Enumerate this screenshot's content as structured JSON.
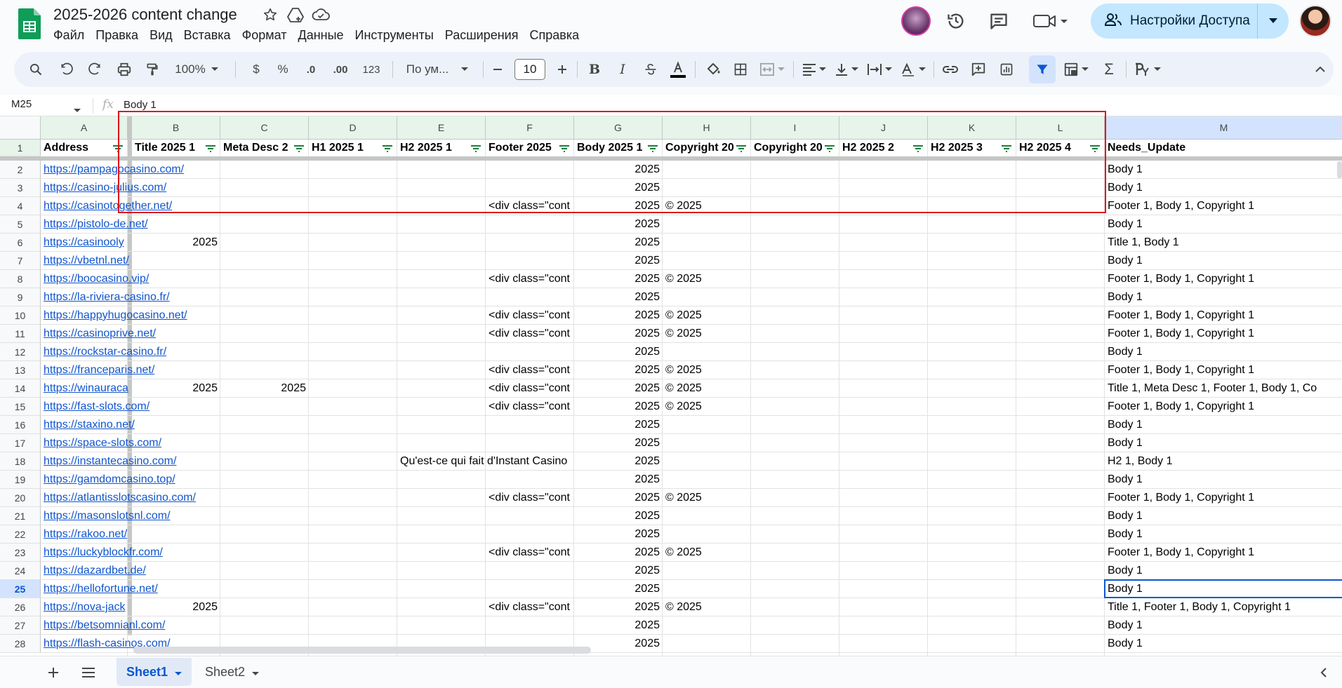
{
  "doc": {
    "title": "2025-2026 content change"
  },
  "menu": [
    "Файл",
    "Правка",
    "Вид",
    "Вставка",
    "Формат",
    "Данные",
    "Инструменты",
    "Расширения",
    "Справка"
  ],
  "share": {
    "label": "Настройки Доступа"
  },
  "toolbar": {
    "zoom": "100%",
    "currency": "$",
    "percent": "%",
    "dec_decrease": ".0",
    "dec_increase": ".00",
    "number_format": "123",
    "font": "По ум...",
    "font_size": "10"
  },
  "formula_bar": {
    "cell_ref": "M25",
    "value": "Body  1"
  },
  "columns": [
    "A",
    "B",
    "C",
    "D",
    "E",
    "F",
    "G",
    "H",
    "I",
    "J",
    "K",
    "L",
    "M"
  ],
  "headers": [
    "Address",
    "Title 2025 1",
    "Meta Desc 2",
    "H1 2025 1",
    "H2 2025 1",
    "Footer 2025",
    "Body 2025 1",
    "Copyright 20",
    "Copyright 20",
    "H2 2025 2",
    "H2 2025 3",
    "H2 2025 4",
    "Needs_Update"
  ],
  "rows": [
    {
      "n": "2",
      "address": "https://pampagocasino.com/",
      "b": "",
      "c": "",
      "e": "",
      "f": "",
      "g": "2025",
      "h": "",
      "m": "Body  1"
    },
    {
      "n": "3",
      "address": "https://casino-julius.com/",
      "b": "",
      "c": "",
      "e": "",
      "f": "",
      "g": "2025",
      "h": "",
      "m": "Body  1"
    },
    {
      "n": "4",
      "address": "https://casinotogether.net/",
      "b": "",
      "c": "",
      "e": "",
      "f": "<div class=\"cont",
      "g": "2025",
      "h": "© 2025",
      "m": "Footer  1, Body  1, Copyright  1"
    },
    {
      "n": "5",
      "address": "https://pistolo-de.net/",
      "b": "",
      "c": "",
      "e": "",
      "f": "",
      "g": "2025",
      "h": "",
      "m": "Body  1"
    },
    {
      "n": "6",
      "address": "https://casinooly",
      "b": "2025",
      "c": "",
      "e": "",
      "f": "",
      "g": "2025",
      "h": "",
      "m": "Title  1, Body  1"
    },
    {
      "n": "7",
      "address": "https://vbetnl.net/",
      "b": "",
      "c": "",
      "e": "",
      "f": "",
      "g": "2025",
      "h": "",
      "m": "Body  1"
    },
    {
      "n": "8",
      "address": "https://boocasino.vip/",
      "b": "",
      "c": "",
      "e": "",
      "f": "<div class=\"cont",
      "g": "2025",
      "h": "© 2025",
      "m": "Footer  1, Body  1, Copyright  1"
    },
    {
      "n": "9",
      "address": "https://la-riviera-casino.fr/",
      "b": "",
      "c": "",
      "e": "",
      "f": "",
      "g": "2025",
      "h": "",
      "m": "Body  1"
    },
    {
      "n": "10",
      "address": "https://happyhugocasino.net/",
      "b": "",
      "c": "",
      "e": "",
      "f": "<div class=\"cont",
      "g": "2025",
      "h": "© 2025",
      "m": "Footer  1, Body  1, Copyright  1"
    },
    {
      "n": "11",
      "address": "https://casinoprive.net/",
      "b": "",
      "c": "",
      "e": "",
      "f": "<div class=\"cont",
      "g": "2025",
      "h": "© 2025",
      "m": "Footer  1, Body  1, Copyright  1"
    },
    {
      "n": "12",
      "address": "https://rockstar-casino.fr/",
      "b": "",
      "c": "",
      "e": "",
      "f": "",
      "g": "2025",
      "h": "",
      "m": "Body  1"
    },
    {
      "n": "13",
      "address": "https://franceparis.net/",
      "b": "",
      "c": "",
      "e": "",
      "f": "<div class=\"cont",
      "g": "2025",
      "h": "© 2025",
      "m": "Footer  1, Body  1, Copyright  1"
    },
    {
      "n": "14",
      "address": "https://winauraca",
      "b": "2025",
      "c": "2025",
      "e": "",
      "f": "<div class=\"cont",
      "g": "2025",
      "h": "© 2025",
      "m": "Title  1, Meta Desc  1, Footer  1, Body  1, Co"
    },
    {
      "n": "15",
      "address": "https://fast-slots.com/",
      "b": "",
      "c": "",
      "e": "",
      "f": "<div class=\"cont",
      "g": "2025",
      "h": "© 2025",
      "m": "Footer  1, Body  1, Copyright  1"
    },
    {
      "n": "16",
      "address": "https://staxino.net/",
      "b": "",
      "c": "",
      "e": "",
      "f": "",
      "g": "2025",
      "h": "",
      "m": "Body  1"
    },
    {
      "n": "17",
      "address": "https://space-slots.com/",
      "b": "",
      "c": "",
      "e": "",
      "f": "",
      "g": "2025",
      "h": "",
      "m": "Body  1"
    },
    {
      "n": "18",
      "address": "https://instantecasino.com/",
      "b": "",
      "c": "",
      "e": "Qu'est-ce qui fait d'Instant Casino",
      "f": "",
      "g": "2025",
      "h": "",
      "m": "H2  1, Body  1"
    },
    {
      "n": "19",
      "address": "https://gamdomcasino.top/",
      "b": "",
      "c": "",
      "e": "",
      "f": "",
      "g": "2025",
      "h": "",
      "m": "Body  1"
    },
    {
      "n": "20",
      "address": "https://atlantisslotscasino.com/",
      "b": "",
      "c": "",
      "e": "",
      "f": "<div class=\"cont",
      "g": "2025",
      "h": "© 2025",
      "m": "Footer  1, Body  1, Copyright  1"
    },
    {
      "n": "21",
      "address": "https://masonslotsnl.com/",
      "b": "",
      "c": "",
      "e": "",
      "f": "",
      "g": "2025",
      "h": "",
      "m": "Body  1"
    },
    {
      "n": "22",
      "address": "https://rakoo.net/",
      "b": "",
      "c": "",
      "e": "",
      "f": "",
      "g": "2025",
      "h": "",
      "m": "Body  1"
    },
    {
      "n": "23",
      "address": "https://luckyblockfr.com/",
      "b": "",
      "c": "",
      "e": "",
      "f": "<div class=\"cont",
      "g": "2025",
      "h": "© 2025",
      "m": "Footer  1, Body  1, Copyright  1"
    },
    {
      "n": "24",
      "address": "https://dazardbet.de/",
      "b": "",
      "c": "",
      "e": "",
      "f": "",
      "g": "2025",
      "h": "",
      "m": "Body  1"
    },
    {
      "n": "25",
      "address": "https://hellofortune.net/",
      "b": "",
      "c": "",
      "e": "",
      "f": "",
      "g": "2025",
      "h": "",
      "m": "Body  1"
    },
    {
      "n": "26",
      "address": "https://nova-jack",
      "b": "2025",
      "c": "",
      "e": "",
      "f": "<div class=\"cont",
      "g": "2025",
      "h": "© 2025",
      "m": "Title  1, Footer  1, Body  1, Copyright  1"
    },
    {
      "n": "27",
      "address": "https://betsomnianl.com/",
      "b": "",
      "c": "",
      "e": "",
      "f": "",
      "g": "2025",
      "h": "",
      "m": "Body  1"
    },
    {
      "n": "28",
      "address": "https://flash-casinos.com/",
      "b": "",
      "c": "",
      "e": "",
      "f": "",
      "g": "2025",
      "h": "",
      "m": "Body  1"
    }
  ],
  "active_cell": {
    "column": "M",
    "row": "25"
  },
  "sheets": [
    "Sheet1",
    "Sheet2"
  ],
  "active_sheet": "Sheet1",
  "colors": {
    "accent": "#0b57d0",
    "link": "#1155cc",
    "annotation": "#e0101a",
    "share_button": "#c2e7ff",
    "header_row": "#e6f4ea"
  }
}
